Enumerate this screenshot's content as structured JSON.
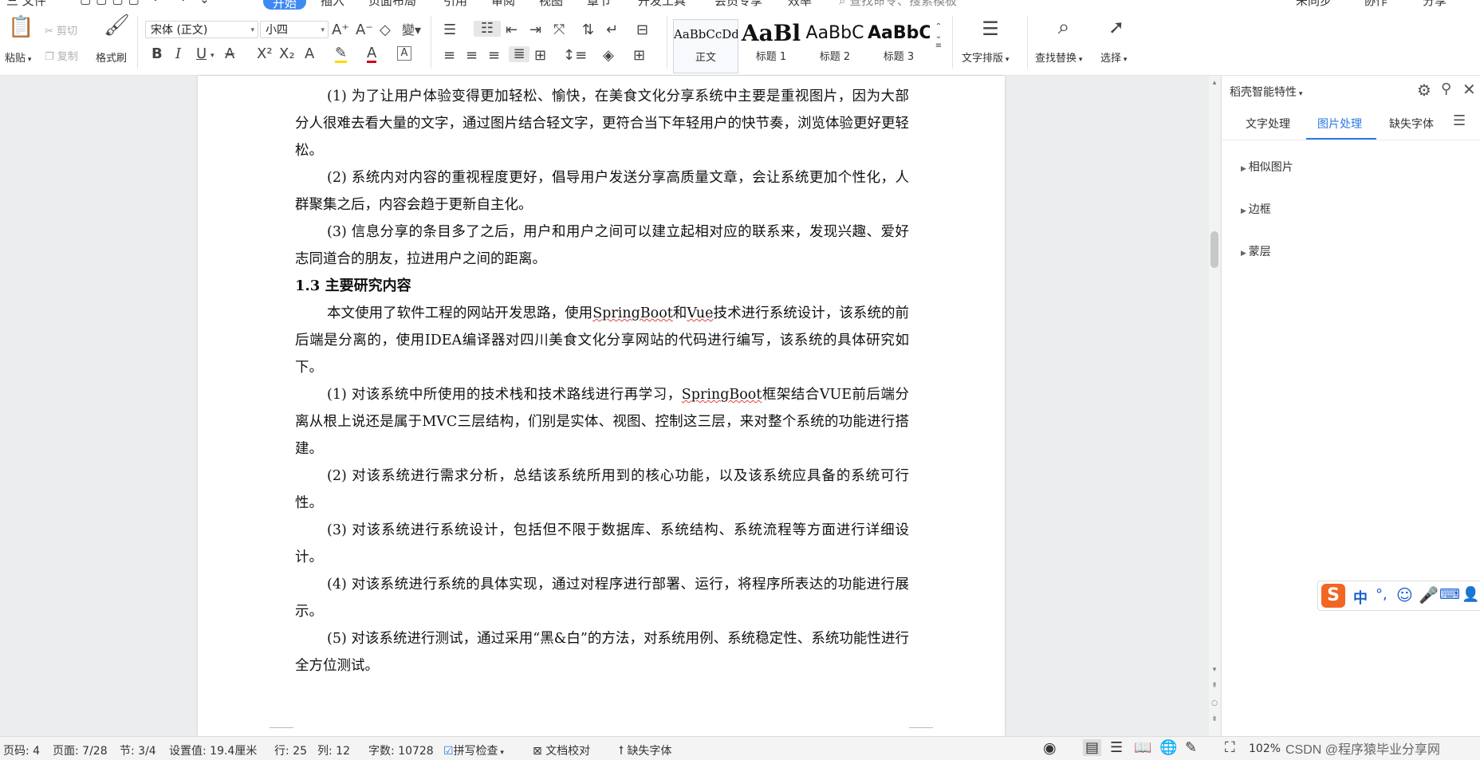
{
  "menubar": {
    "file": "三 文件",
    "tabs": [
      "开始",
      "插入",
      "页面布局",
      "引用",
      "审阅",
      "视图",
      "章节",
      "开发工具",
      "会员专享",
      "效率"
    ],
    "search": "查找命令、搜索模板",
    "right": [
      "未同步",
      "协作",
      "分享"
    ]
  },
  "ribbon": {
    "paste": "粘贴",
    "cut": "剪切",
    "copy": "复制",
    "format_painter": "格式刷",
    "font_name": "宋体 (正文)",
    "font_size": "小四",
    "bold": "B",
    "italic": "I",
    "underline": "U",
    "styles": [
      {
        "sample": "AaBbCcDd",
        "label": "正文"
      },
      {
        "sample": "AaBl",
        "label": "标题 1"
      },
      {
        "sample": "AaBbC",
        "label": "标题 2"
      },
      {
        "sample": "AaBbC",
        "label": "标题 3"
      }
    ],
    "text_layout": "文字排版",
    "find_replace": "查找替换",
    "select": "选择"
  },
  "document": {
    "p1": "(1)  为了让用户体验变得更加轻松、愉快，在美食文化分享系统中主要是重视图片，因为大部分人很难去看大量的文字，通过图片结合轻文字，更符合当下年轻用户的快节奏，浏览体验更好更轻松。",
    "p2": "(2)  系统内对内容的重视程度更好，倡导用户发送分享高质量文章，会让系统更加个性化，人群聚集之后，内容会趋于更新自主化。",
    "p3": "(3)  信息分享的条目多了之后，用户和用户之间可以建立起相对应的联系来，发现兴趣、爱好志同道合的朋友，拉进用户之间的距离。",
    "heading": "1.3  主要研究内容",
    "p4a": "本文使用了软件工程的网站开发思路，使用",
    "p4b": "SpringBoot",
    "p4c": "和",
    "p4d": "Vue",
    "p4e": "技术进行系统设计，该系统的前后端是分离的，使用IDEA编译器对四川美食文化分享网站的代码进行编写，该系统的具体研究如下。",
    "p5a": "(1)  对该系统中所使用的技术栈和技术路线进行再学习，",
    "p5b": "SpringBoot",
    "p5c": "框架结合VUE前后端分离从根上说还是属于MVC三层结构，们别是实体、视图、控制这三层，来对整个系统的功能进行搭建。",
    "p6": "(2)  对该系统进行需求分析，总结该系统所用到的核心功能，以及该系统应具备的系统可行性。",
    "p7": "(3)  对该系统进行系统设计，包括但不限于数据库、系统结构、系统流程等方面进行详细设计。",
    "p8": "(4)  对该系统进行系统的具体实现，通过对程序进行部署、运行，将程序所表达的功能进行展示。",
    "p9": "(5)  对该系统进行测试，通过采用“黑&白”的方法，对系统用例、系统稳定性、系统功能性进行全方位测试。"
  },
  "sidepanel": {
    "title": "稻壳智能特性",
    "tabs": [
      "文字处理",
      "图片处理",
      "缺失字体"
    ],
    "active_tab": "图片处理",
    "items": [
      "相似图片",
      "边框",
      "蒙层"
    ]
  },
  "ime": {
    "mode": "中"
  },
  "statusbar": {
    "page_code": "页码: 4",
    "page": "页面: 7/28",
    "section": "节: 3/4",
    "setting": "设置值: 19.4厘米",
    "row": "行: 25",
    "col": "列: 12",
    "word_count": "字数: 10728",
    "spell_check": "拼写检查",
    "doc_proof": "文档校对",
    "missing_font": "缺失字体",
    "zoom": "102%",
    "watermark": "CSDN @程序猿毕业分享网"
  },
  "colors": {
    "accent": "#3e8af5",
    "logo_orange": "#f26522"
  }
}
